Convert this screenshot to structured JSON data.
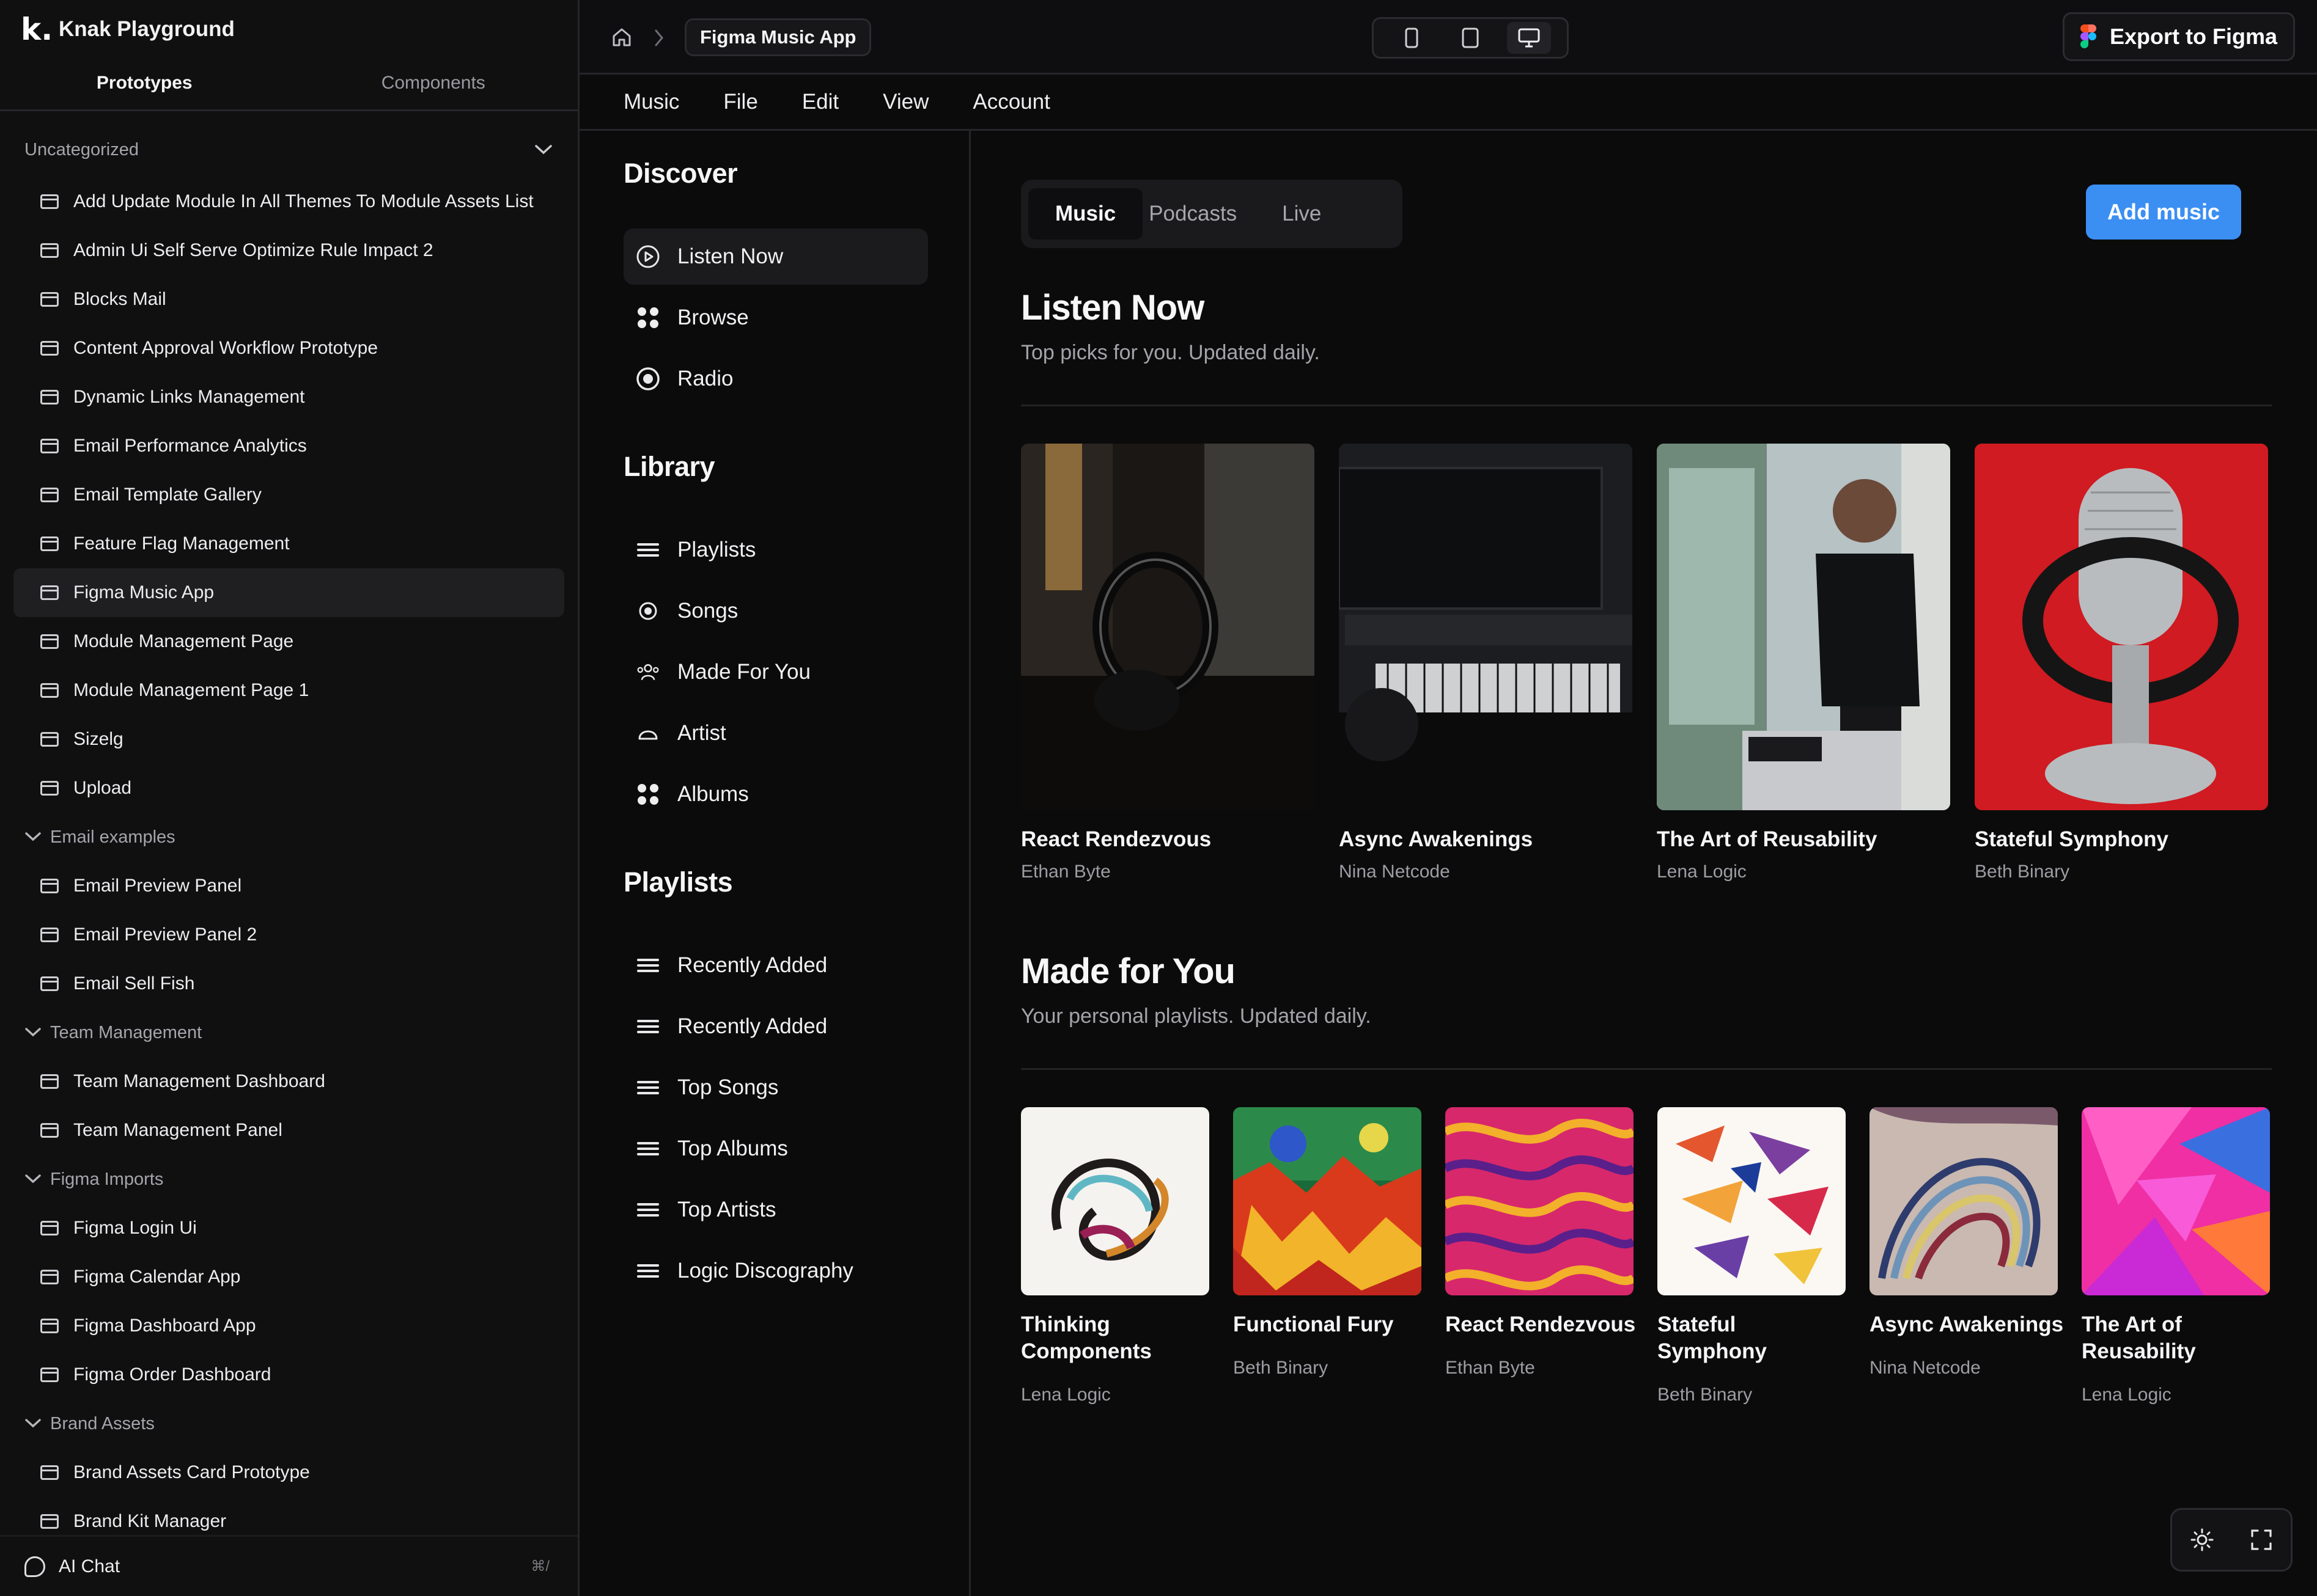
{
  "brand": {
    "logo": "k.",
    "title": "Knak Playground"
  },
  "sidebar": {
    "tabs": [
      "Prototypes",
      "Components"
    ],
    "groups": [
      {
        "name": "Uncategorized",
        "items": [
          "Add Update Module In All Themes To Module Assets List",
          "Admin Ui Self Serve Optimize Rule Impact 2",
          "Blocks Mail",
          "Content Approval Workflow Prototype",
          "Dynamic Links Management",
          "Email Performance Analytics",
          "Email Template Gallery",
          "Feature Flag Management",
          "Figma Music App",
          "Module Management Page",
          "Module Management Page 1",
          "Sizelg",
          "Upload"
        ]
      },
      {
        "name": "Email examples",
        "items": [
          "Email Preview Panel",
          "Email Preview Panel 2",
          "Email Sell Fish"
        ]
      },
      {
        "name": "Team Management",
        "items": [
          "Team Management Dashboard",
          "Team Management Panel"
        ]
      },
      {
        "name": "Figma Imports",
        "items": [
          "Figma Login Ui",
          "Figma Calendar App",
          "Figma Dashboard App",
          "Figma Order Dashboard"
        ]
      },
      {
        "name": "Brand Assets",
        "items": [
          "Brand Assets Card Prototype",
          "Brand Kit Manager"
        ]
      }
    ],
    "active_item": "Figma Music App",
    "footer": {
      "label": "AI Chat",
      "shortcut": "⌘/"
    }
  },
  "topbar": {
    "breadcrumb": "Figma Music App",
    "export_label": "Export to Figma"
  },
  "menubar": [
    "Music",
    "File",
    "Edit",
    "View",
    "Account"
  ],
  "music_nav": {
    "discover_title": "Discover",
    "discover": [
      {
        "label": "Listen Now",
        "icon": "play-circle-icon"
      },
      {
        "label": "Browse",
        "icon": "grid-icon"
      },
      {
        "label": "Radio",
        "icon": "radio-icon"
      }
    ],
    "library_title": "Library",
    "library": [
      {
        "label": "Playlists",
        "icon": "list-icon"
      },
      {
        "label": "Songs",
        "icon": "song-icon"
      },
      {
        "label": "Made For You",
        "icon": "users-icon"
      },
      {
        "label": "Artist",
        "icon": "artist-icon"
      },
      {
        "label": "Albums",
        "icon": "grid-icon"
      }
    ],
    "playlists_title": "Playlists",
    "playlists": [
      "Recently Added",
      "Recently Added",
      "Top Songs",
      "Top Albums",
      "Top Artists",
      "Logic Discography"
    ]
  },
  "main": {
    "tabs": [
      "Music",
      "Podcasts",
      "Live"
    ],
    "add_button": "Add music",
    "listen_now": {
      "title": "Listen Now",
      "subtitle": "Top picks for you. Updated daily.",
      "cards": [
        {
          "title": "React Rendezvous",
          "artist": "Ethan Byte"
        },
        {
          "title": "Async Awakenings",
          "artist": "Nina Netcode"
        },
        {
          "title": "The Art of Reusability",
          "artist": "Lena Logic"
        },
        {
          "title": "Stateful Symphony",
          "artist": "Beth Binary"
        }
      ]
    },
    "made_for_you": {
      "title": "Made for You",
      "subtitle": "Your personal playlists. Updated daily.",
      "cards": [
        {
          "title1": "Thinking",
          "title2": "Components",
          "artist": "Lena Logic"
        },
        {
          "title1": "Functional Fury",
          "title2": "",
          "artist": "Beth Binary"
        },
        {
          "title1": "React Rendezvous",
          "title2": "",
          "artist": "Ethan Byte"
        },
        {
          "title1": "Stateful",
          "title2": "Symphony",
          "artist": "Beth Binary"
        },
        {
          "title1": "Async Awakenings",
          "title2": "",
          "artist": "Nina Netcode"
        },
        {
          "title1": "The Art of",
          "title2": "Reusability",
          "artist": "Lena Logic"
        }
      ]
    }
  },
  "colors": {
    "accent": "#3b8ff3",
    "bg": "#0b0b0c",
    "sidebar_bg": "#101011"
  }
}
